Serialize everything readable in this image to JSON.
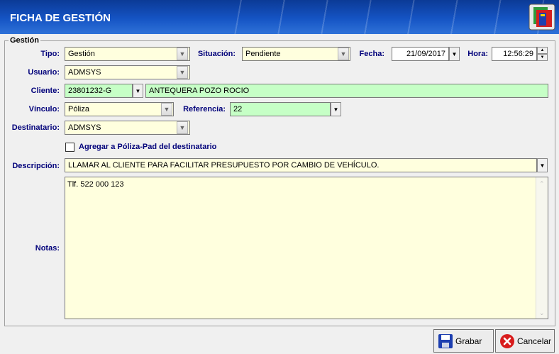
{
  "window": {
    "title": "FICHA DE GESTIÓN",
    "logo_icon": "app-logo-icon"
  },
  "group": {
    "label": "Gestión"
  },
  "labels": {
    "tipo": "Tipo:",
    "situacion": "Situación:",
    "fecha": "Fecha:",
    "hora": "Hora:",
    "usuario": "Usuario:",
    "cliente": "Cliente:",
    "vinculo": "Vínculo:",
    "referencia": "Referencia:",
    "destinatario": "Destinatario:",
    "descripcion": "Descripción:",
    "notas": "Notas:"
  },
  "fields": {
    "tipo": "Gestión",
    "situacion": "Pendiente",
    "fecha": "21/09/2017",
    "hora": "12:56:29",
    "usuario": "ADMSYS",
    "cliente_code": "23801232-G",
    "cliente_name": "ANTEQUERA POZO ROCIO",
    "vinculo": "Póliza",
    "referencia": "22",
    "destinatario": "ADMSYS",
    "descripcion": "LLAMAR AL CLIENTE PARA FACILITAR PRESUPUESTO POR CAMBIO DE VEHÍCULO.",
    "notas": "Tlf. 522 000 123"
  },
  "checkbox": {
    "label": "Agregar a Póliza-Pad del destinatario",
    "checked": false
  },
  "buttons": {
    "grabar": "Grabar",
    "cancelar": "Cancelar"
  },
  "colors": {
    "label_blue": "#00007a",
    "field_yellow": "#ffffde",
    "field_green": "#c6ffc6",
    "title_bar": "#1554c4"
  }
}
